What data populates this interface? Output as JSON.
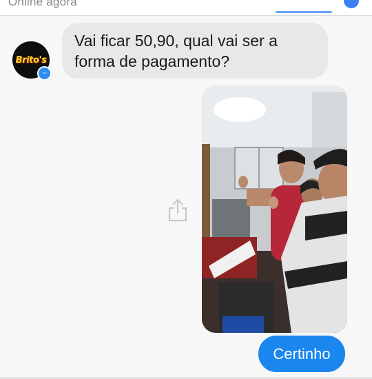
{
  "header": {
    "status": "Online agora"
  },
  "contact": {
    "avatar_text": "Brito's",
    "badge_icon": "messenger-icon"
  },
  "messages": [
    {
      "from": "contact",
      "text": "Vai ficar 50,90, qual vai ser a forma de pagamento?"
    },
    {
      "from": "me",
      "type": "photo"
    },
    {
      "from": "me",
      "text": "Certinho"
    }
  ],
  "colors": {
    "incoming_bubble": "#e8e8e8",
    "outgoing_bubble": "#1a87ee",
    "messenger_badge": "#2f8cf2",
    "brand_yellow": "#ffd21a"
  }
}
